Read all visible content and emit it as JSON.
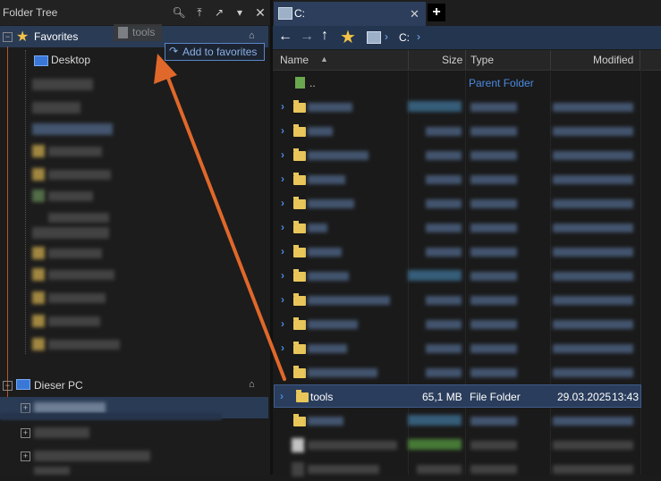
{
  "left_pane": {
    "title": "Folder Tree",
    "favorites_label": "Favorites",
    "desktop_label": "Desktop",
    "this_pc_label": "Dieser PC"
  },
  "drag": {
    "ghost_label": "tools",
    "tooltip": "Add to favorites"
  },
  "tab": {
    "title": "C:"
  },
  "address": {
    "path": "C:"
  },
  "columns": {
    "name": "Name",
    "size": "Size",
    "type": "Type",
    "modified": "Modified"
  },
  "parent_row": {
    "name": "..",
    "type": "Parent Folder"
  },
  "selected_row": {
    "name": "tools",
    "size": "65,1 MB",
    "type": "File Folder",
    "date": "29.03.2025",
    "time": "13:43"
  },
  "colors": {
    "accent": "#2a3b55",
    "arrow": "#e0682a",
    "folder": "#e8c65a",
    "link": "#4a8ae0"
  }
}
